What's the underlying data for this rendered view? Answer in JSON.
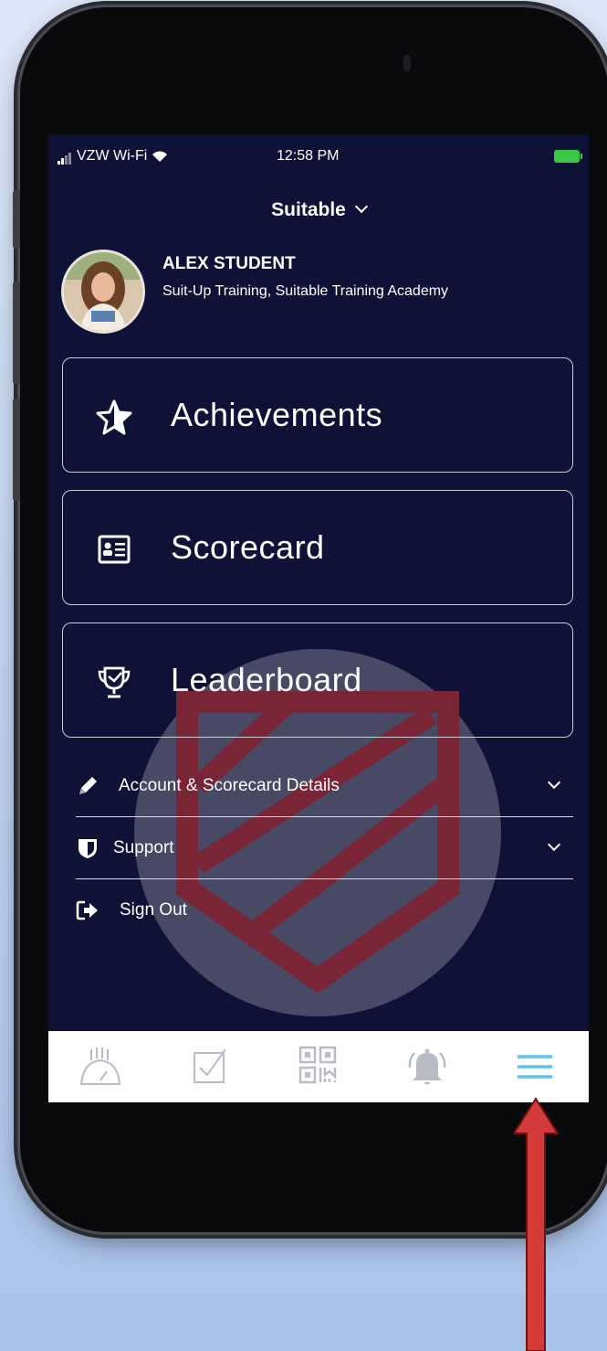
{
  "status_bar": {
    "carrier": "VZW Wi-Fi",
    "time": "12:58 PM",
    "battery_color": "#36c843"
  },
  "header": {
    "account_name": "Suitable"
  },
  "profile": {
    "name": "ALEX STUDENT",
    "organization": "Suit-Up Training, Suitable Training Academy"
  },
  "cards": [
    {
      "label": "Achievements",
      "icon": "star-icon"
    },
    {
      "label": "Scorecard",
      "icon": "id-card-icon"
    },
    {
      "label": "Leaderboard",
      "icon": "trophy-icon"
    }
  ],
  "menu": [
    {
      "label": "Account & Scorecard Details",
      "icon": "pencil-icon",
      "expandable": true
    },
    {
      "label": "Support",
      "icon": "shield-icon",
      "expandable": true
    },
    {
      "label": "Sign Out",
      "icon": "sign-out-icon",
      "expandable": false
    }
  ],
  "tab_bar": {
    "tabs": [
      "dashboard-gauge-icon",
      "checklist-icon",
      "qr-code-icon",
      "notification-bell-icon",
      "hamburger-menu-icon"
    ],
    "active_tab": "hamburger-menu-icon",
    "active_color": "#5bc3ea",
    "inactive_color": "#b9bcc6"
  },
  "colors": {
    "screen_background": "#0f1237",
    "watermark_logo": "#7a2535",
    "pointer_arrow": "#d33b3b"
  }
}
